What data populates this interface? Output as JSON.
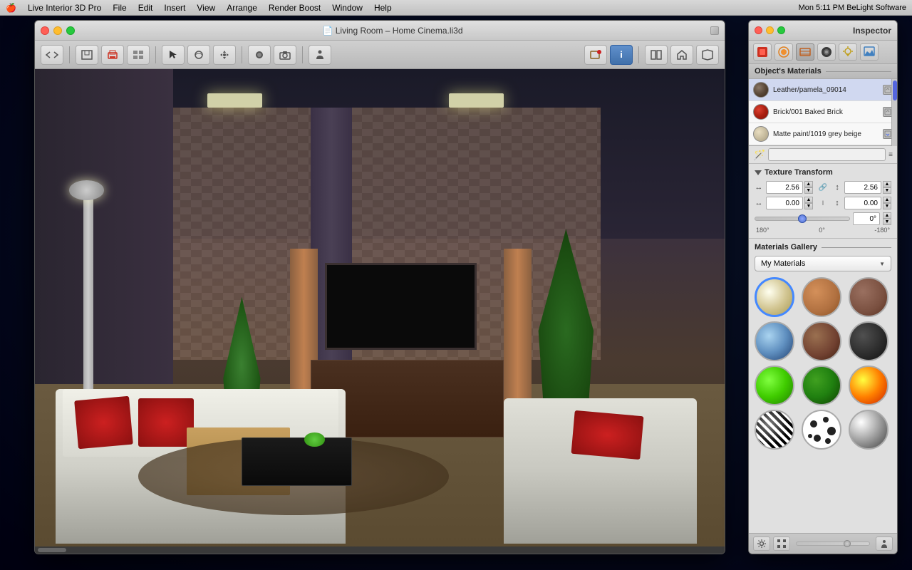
{
  "menubar": {
    "apple": "🍎",
    "items": [
      "Live Interior 3D Pro",
      "File",
      "Edit",
      "Insert",
      "View",
      "Arrange",
      "Render Boost",
      "Window",
      "Help"
    ],
    "right": "Mon 5:11 PM   BeLight Software"
  },
  "main_window": {
    "title": "📄 Living Room – Home Cinema.li3d",
    "traffic_lights": [
      "close",
      "minimize",
      "maximize"
    ]
  },
  "toolbar": {
    "buttons": [
      "←→",
      "⊞",
      "🖨",
      "⊟",
      "↖",
      "↻",
      "⊕",
      "●",
      "◉",
      "◎",
      "⚙",
      "📷",
      "🏠",
      "ℹ",
      "⊞",
      "🏠",
      "🏠"
    ]
  },
  "inspector": {
    "title": "Inspector",
    "tabs": [
      "🔴",
      "🟠",
      "✏",
      "💿",
      "💡",
      "🏠"
    ],
    "objects_materials_label": "Object's Materials",
    "materials": [
      {
        "name": "Leather/pamela_09014",
        "color": "#5a5050",
        "type": "dark"
      },
      {
        "name": "Brick/001 Baked Brick",
        "color": "#cc3020",
        "type": "red"
      },
      {
        "name": "Matte paint/1019 grey beige",
        "color": "#d4c8a8",
        "type": "light"
      }
    ],
    "texture_transform": {
      "label": "Texture Transform",
      "scale_x": "2.56",
      "scale_y": "2.56",
      "offset_x": "0.00",
      "offset_y": "0.00",
      "rotation": "0°",
      "slider_min": "180°",
      "slider_mid": "0°",
      "slider_max": "-180°"
    },
    "gallery": {
      "label": "Materials Gallery",
      "dropdown_value": "My Materials",
      "items": [
        {
          "id": "ivory",
          "class": "mat-ivory",
          "selected": true
        },
        {
          "id": "wood-light",
          "class": "mat-wood-light",
          "selected": false
        },
        {
          "id": "brick",
          "class": "mat-brick",
          "selected": false
        },
        {
          "id": "water",
          "class": "mat-water",
          "selected": false
        },
        {
          "id": "wood-dark",
          "class": "mat-wood-dark",
          "selected": false
        },
        {
          "id": "dark",
          "class": "mat-dark",
          "selected": false
        },
        {
          "id": "green-bright",
          "class": "mat-green-bright",
          "selected": false
        },
        {
          "id": "green-dark",
          "class": "mat-green-dark",
          "selected": false
        },
        {
          "id": "fire",
          "class": "mat-fire",
          "selected": false
        },
        {
          "id": "zebra",
          "class": "mat-zebra",
          "selected": false
        },
        {
          "id": "dalmatian",
          "class": "mat-dalmatian",
          "selected": false
        },
        {
          "id": "chrome",
          "class": "mat-chrome",
          "selected": false
        }
      ]
    }
  }
}
